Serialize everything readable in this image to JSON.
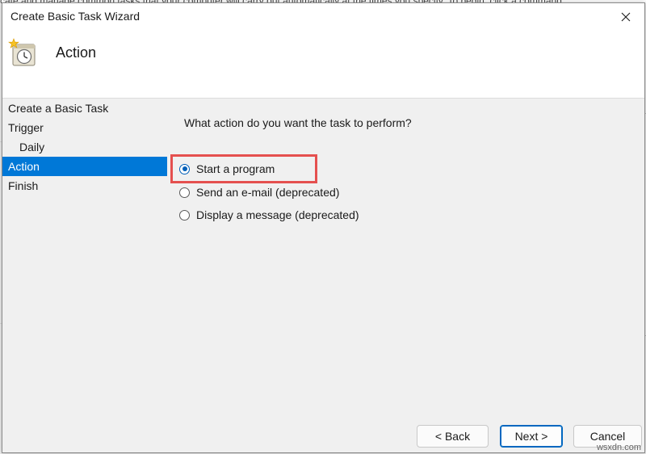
{
  "background": {
    "text": "cate and manage common tasks that your computer will carry out automatically at the times you specify. To begin, click a command"
  },
  "dialog": {
    "title": "Create Basic Task Wizard",
    "close_glyph": "✕",
    "header_title": "Action",
    "header_icon": "clock-task-icon"
  },
  "sidebar": {
    "items": [
      {
        "label": "Create a Basic Task"
      },
      {
        "label": "Trigger"
      },
      {
        "label": "Daily"
      },
      {
        "label": "Action"
      },
      {
        "label": "Finish"
      }
    ],
    "active_index": 3
  },
  "content": {
    "question": "What action do you want the task to perform?",
    "options": [
      {
        "label": "Start a program",
        "checked": true
      },
      {
        "label": "Send an e-mail (deprecated)",
        "checked": false
      },
      {
        "label": "Display a message (deprecated)",
        "checked": false
      }
    ]
  },
  "buttons": {
    "back": "< Back",
    "next": "Next >",
    "cancel": "Cancel"
  },
  "watermark": "wsxdn.com",
  "colors": {
    "selection": "#0078d7",
    "highlight": "#e5504f",
    "radio_accent": "#005fb8"
  }
}
